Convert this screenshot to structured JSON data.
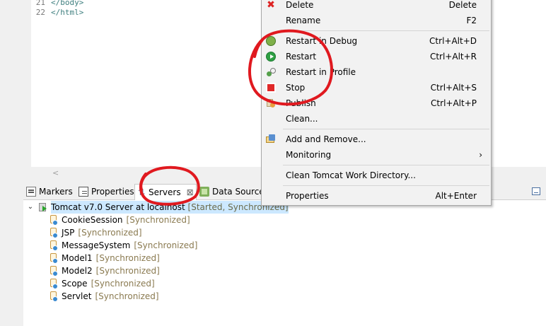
{
  "editor": {
    "lines": [
      {
        "num": "21",
        "code": "</body>"
      },
      {
        "num": "22",
        "code": "</html>"
      }
    ],
    "hscroll_left": "<"
  },
  "view_tabs": [
    {
      "id": "markers",
      "label": "Markers"
    },
    {
      "id": "properties",
      "label": "Properties"
    },
    {
      "id": "servers",
      "label": "Servers",
      "close": "⊠"
    },
    {
      "id": "datasource",
      "label": "Data Source"
    }
  ],
  "servers": {
    "server_name": "Tomcat v7.0 Server at localhost",
    "server_status": "[Started, Synchronized]",
    "expander": "⌄",
    "modules": [
      {
        "name": "CookieSession",
        "status": "[Synchronized]"
      },
      {
        "name": "JSP",
        "status": "[Synchronized]"
      },
      {
        "name": "MessageSystem",
        "status": "[Synchronized]"
      },
      {
        "name": "Model1",
        "status": "[Synchronized]"
      },
      {
        "name": "Model2",
        "status": "[Synchronized]"
      },
      {
        "name": "Scope",
        "status": "[Synchronized]"
      },
      {
        "name": "Servlet",
        "status": "[Synchronized]"
      }
    ]
  },
  "context_menu": {
    "items": [
      {
        "label": "Delete",
        "shortcut": "Delete",
        "icon": "delete-icon"
      },
      {
        "label": "Rename",
        "shortcut": "F2"
      },
      {
        "label": "Restart in Debug",
        "shortcut": "Ctrl+Alt+D",
        "icon": "debug-icon"
      },
      {
        "label": "Restart",
        "shortcut": "Ctrl+Alt+R",
        "icon": "restart-icon"
      },
      {
        "label": "Restart in Profile",
        "shortcut": "",
        "icon": "profile-icon"
      },
      {
        "label": "Stop",
        "shortcut": "Ctrl+Alt+S",
        "icon": "stop-icon"
      },
      {
        "label": "Publish",
        "shortcut": "Ctrl+Alt+P",
        "icon": "publish-icon"
      },
      {
        "label": "Clean...",
        "shortcut": ""
      },
      {
        "label": "Add and Remove...",
        "shortcut": "",
        "icon": "add-remove-icon"
      },
      {
        "label": "Monitoring",
        "submenu": "›"
      },
      {
        "label": "Clean Tomcat Work Directory...",
        "shortcut": ""
      },
      {
        "label": "Properties",
        "shortcut": "Alt+Enter"
      }
    ]
  },
  "colors": {
    "annotation": "#e0191f",
    "selection": "#cce8ff",
    "status_text": "#8a7a50"
  }
}
